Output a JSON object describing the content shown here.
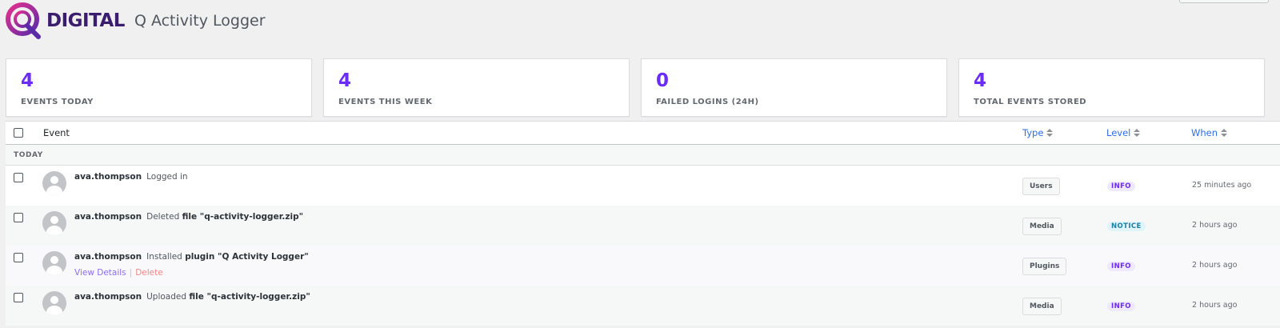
{
  "header": {
    "logo_text": "DIGITAL",
    "app_title": "Q Activity Logger"
  },
  "colors": {
    "accent": "#6b2cf5",
    "logo_gradient_start": "#e6318e",
    "logo_gradient_end": "#5b2aa8",
    "link": "#2c6ee8"
  },
  "stats": [
    {
      "value": "4",
      "label": "EVENTS TODAY"
    },
    {
      "value": "4",
      "label": "EVENTS THIS WEEK"
    },
    {
      "value": "0",
      "label": "FAILED LOGINS (24H)"
    },
    {
      "value": "4",
      "label": "TOTAL EVENTS STORED"
    }
  ],
  "table": {
    "columns": {
      "event": "Event",
      "type": "Type",
      "level": "Level",
      "when": "When"
    },
    "group_label": "TODAY",
    "rows": [
      {
        "user": "ava.thompson",
        "action": "Logged in",
        "object": "",
        "type": "Users",
        "level": "INFO",
        "when": "25 minutes ago"
      },
      {
        "user": "ava.thompson",
        "action": "Deleted",
        "object": "file \"q-activity-logger.zip\"",
        "type": "Media",
        "level": "NOTICE",
        "when": "2 hours ago"
      },
      {
        "user": "ava.thompson",
        "action": "Installed",
        "object": "plugin \"Q Activity Logger\"",
        "type": "Plugins",
        "level": "INFO",
        "when": "2 hours ago"
      },
      {
        "user": "ava.thompson",
        "action": "Uploaded",
        "object": "file \"q-activity-logger.zip\"",
        "type": "Media",
        "level": "INFO",
        "when": "2 hours ago"
      }
    ],
    "row_actions": {
      "view": "View Details",
      "separator": "|",
      "delete": "Delete"
    }
  }
}
